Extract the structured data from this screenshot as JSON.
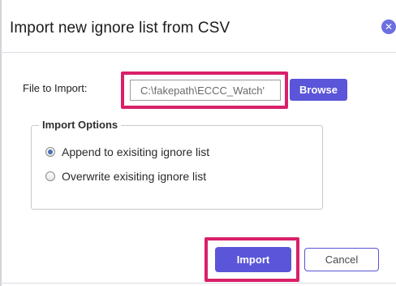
{
  "dialog": {
    "title": "Import new ignore list from CSV",
    "close_icon": "close-icon"
  },
  "file": {
    "label": "File to Import:",
    "value": "C:\\fakepath\\ECCC_Watch'",
    "browse_label": "Browse"
  },
  "options": {
    "legend": "Import Options",
    "items": [
      {
        "label": "Append to exisiting ignore list",
        "checked": true
      },
      {
        "label": "Overwrite exisiting ignore list",
        "checked": false
      }
    ]
  },
  "footer": {
    "import_label": "Import",
    "cancel_label": "Cancel"
  },
  "colors": {
    "accent": "#5a55d9",
    "highlight": "#d9206a",
    "close": "#6b6fe0"
  }
}
